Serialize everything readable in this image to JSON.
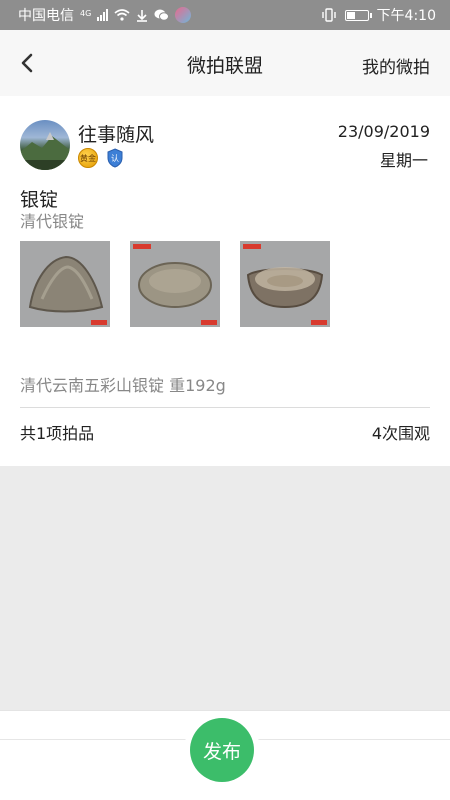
{
  "status_bar": {
    "carrier": "中国电信",
    "network": "4G",
    "time": "下午4:10",
    "icons": [
      "signal-icon",
      "wifi-icon",
      "download-icon",
      "wechat-icon",
      "app-icon",
      "vibrate-icon",
      "battery-icon"
    ]
  },
  "nav": {
    "back_icon": "chevron-left-icon",
    "title": "微拍联盟",
    "right_label": "我的微拍"
  },
  "post": {
    "username": "往事随风",
    "badges": [
      {
        "icon": "gold-member-badge-icon",
        "text": "黄金"
      },
      {
        "icon": "verified-shield-icon",
        "text": "认"
      }
    ],
    "date": "23/09/2019",
    "weekday": "星期一",
    "item_title": "银锭",
    "item_subtitle": "清代银锭",
    "photos": [
      {
        "name": "ingot-photo-1",
        "shape": "triangle"
      },
      {
        "name": "ingot-photo-2",
        "shape": "oval"
      },
      {
        "name": "ingot-photo-3",
        "shape": "boat"
      }
    ],
    "description": "清代云南五彩山银锭 重192g",
    "item_count": "共1项拍品",
    "view_count": "4次围观"
  },
  "bottom": {
    "publish_label": "发布"
  },
  "colors": {
    "accent_green": "#3cbd6a",
    "status_bar": "#8e8e8e",
    "page_bg": "#ebebeb",
    "muted_text": "#888888"
  }
}
